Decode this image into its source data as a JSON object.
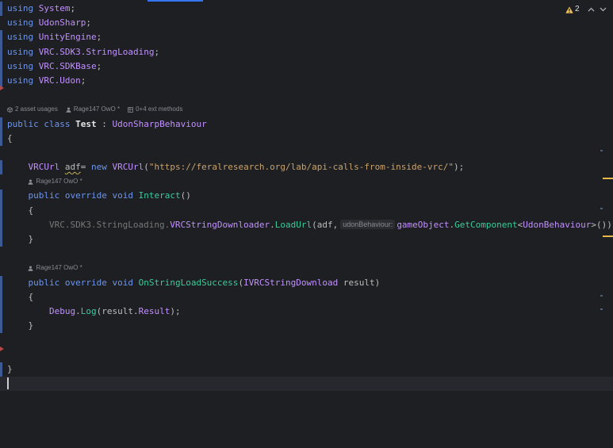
{
  "editor": {
    "lines": [
      {
        "indent": 0,
        "t": [
          [
            "kw",
            "using"
          ],
          [
            "p",
            " "
          ],
          [
            "ns",
            "System"
          ],
          [
            "p",
            ";"
          ]
        ]
      },
      {
        "indent": 0,
        "t": [
          [
            "kw",
            "using"
          ],
          [
            "p",
            " "
          ],
          [
            "ns",
            "UdonSharp"
          ],
          [
            "p",
            ";"
          ]
        ]
      },
      {
        "indent": 0,
        "t": [
          [
            "kw",
            "using"
          ],
          [
            "p",
            " "
          ],
          [
            "ns",
            "UnityEngine"
          ],
          [
            "p",
            ";"
          ]
        ]
      },
      {
        "indent": 0,
        "t": [
          [
            "kw",
            "using"
          ],
          [
            "p",
            " "
          ],
          [
            "ns",
            "VRC.SDK3.StringLoading"
          ],
          [
            "p",
            ";"
          ]
        ]
      },
      {
        "indent": 0,
        "t": [
          [
            "kw",
            "using"
          ],
          [
            "p",
            " "
          ],
          [
            "ns",
            "VRC.SDKBase"
          ],
          [
            "p",
            ";"
          ]
        ]
      },
      {
        "indent": 0,
        "t": [
          [
            "kw",
            "using"
          ],
          [
            "p",
            " "
          ],
          [
            "ns",
            "VRC.Udon"
          ],
          [
            "p",
            ";"
          ]
        ]
      },
      {
        "indent": 0,
        "t": []
      },
      {
        "indent": 0,
        "hint": [
          {
            "icon": "unity-asset-icon",
            "text": "2 asset usages"
          },
          {
            "icon": "author-icon",
            "text": "Rage147 OwO *"
          },
          {
            "icon": "extension-methods-icon",
            "text": "0+4 ext methods"
          }
        ]
      },
      {
        "indent": 0,
        "t": [
          [
            "kw",
            "public"
          ],
          [
            "p",
            " "
          ],
          [
            "kw",
            "class"
          ],
          [
            "p",
            " "
          ],
          [
            "decl",
            "Test"
          ],
          [
            "p",
            " : "
          ],
          [
            "type",
            "UdonSharpBehaviour"
          ]
        ]
      },
      {
        "indent": 0,
        "t": [
          [
            "p",
            "{"
          ]
        ]
      },
      {
        "indent": 0,
        "t": []
      },
      {
        "indent": 1,
        "t": [
          [
            "type",
            "VRCUrl"
          ],
          [
            "p",
            " "
          ],
          [
            "warn",
            "adf"
          ],
          [
            "p",
            "= "
          ],
          [
            "kw",
            "new"
          ],
          [
            "p",
            " "
          ],
          [
            "type",
            "VRCUrl"
          ],
          [
            "p",
            "("
          ],
          [
            "str",
            "\"https://feralresearch.org/lab/api-calls-from-inside-vrc/\""
          ],
          [
            "p",
            ");"
          ]
        ]
      },
      {
        "indent": 1,
        "hint": [
          {
            "icon": "author-icon",
            "text": "Rage147 OwO *"
          }
        ]
      },
      {
        "indent": 1,
        "t": [
          [
            "kw",
            "public"
          ],
          [
            "p",
            " "
          ],
          [
            "kw",
            "override"
          ],
          [
            "p",
            " "
          ],
          [
            "kw",
            "void"
          ],
          [
            "p",
            " "
          ],
          [
            "method",
            "Interact"
          ],
          [
            "p",
            "()"
          ]
        ]
      },
      {
        "indent": 1,
        "t": [
          [
            "p",
            "{"
          ]
        ]
      },
      {
        "indent": 2,
        "t": [
          [
            "dim",
            "VRC.SDK3.StringLoading."
          ],
          [
            "type",
            "VRCStringDownloader"
          ],
          [
            "p",
            "."
          ],
          [
            "method",
            "LoadUrl"
          ],
          [
            "p",
            "("
          ],
          [
            "var",
            "adf"
          ],
          [
            "p",
            ","
          ],
          [
            "param_hint",
            "udonBehaviour:"
          ],
          [
            "prop",
            "gameObject"
          ],
          [
            "p",
            "."
          ],
          [
            "method",
            "GetComponent"
          ],
          [
            "p",
            "<"
          ],
          [
            "type",
            "UdonBehaviour"
          ],
          [
            "p",
            ">());"
          ]
        ]
      },
      {
        "indent": 1,
        "t": [
          [
            "p",
            "}"
          ]
        ]
      },
      {
        "indent": 0,
        "t": []
      },
      {
        "indent": 1,
        "hint": [
          {
            "icon": "author-icon",
            "text": "Rage147 OwO *"
          }
        ]
      },
      {
        "indent": 1,
        "t": [
          [
            "kw",
            "public"
          ],
          [
            "p",
            " "
          ],
          [
            "kw",
            "override"
          ],
          [
            "p",
            " "
          ],
          [
            "kw",
            "void"
          ],
          [
            "p",
            " "
          ],
          [
            "method",
            "OnStringLoadSuccess"
          ],
          [
            "p",
            "("
          ],
          [
            "type",
            "IVRCStringDownload"
          ],
          [
            "p",
            " "
          ],
          [
            "var",
            "result"
          ],
          [
            "p",
            ")"
          ]
        ]
      },
      {
        "indent": 1,
        "t": [
          [
            "p",
            "{"
          ]
        ]
      },
      {
        "indent": 2,
        "t": [
          [
            "type",
            "Debug"
          ],
          [
            "p",
            "."
          ],
          [
            "method",
            "Log"
          ],
          [
            "p",
            "("
          ],
          [
            "var",
            "result"
          ],
          [
            "p",
            "."
          ],
          [
            "prop",
            "Result"
          ],
          [
            "p",
            ");"
          ]
        ]
      },
      {
        "indent": 1,
        "t": [
          [
            "p",
            "}"
          ]
        ]
      },
      {
        "indent": 0,
        "t": []
      },
      {
        "indent": 0,
        "t": []
      },
      {
        "indent": 0,
        "t": [
          [
            "p",
            "}"
          ]
        ]
      },
      {
        "indent": 0,
        "t": [],
        "current": true
      }
    ]
  },
  "inspection_widget": {
    "warning_icon": "warning-icon",
    "warning_count": "2",
    "prev_icon": "chevron-up-icon",
    "next_icon": "chevron-down-icon"
  },
  "theme": {
    "background": "#1e1f22",
    "current_line": "#26282e",
    "caret": "#cecece",
    "warning": "#f2c55c",
    "accent": "#3574f0",
    "syntax": {
      "kw": "#6c95eb",
      "ns": "#c191ff",
      "type": "#c191ff",
      "decl": "#e6e6e6",
      "warn": "#bdbdbd",
      "var": "#bdbdbd",
      "method": "#39cc9b",
      "str": "#c9a26d",
      "p": "#bdbdbd",
      "dim": "#787878",
      "prop": "#c191ff",
      "param_hint": "#868a91"
    }
  }
}
